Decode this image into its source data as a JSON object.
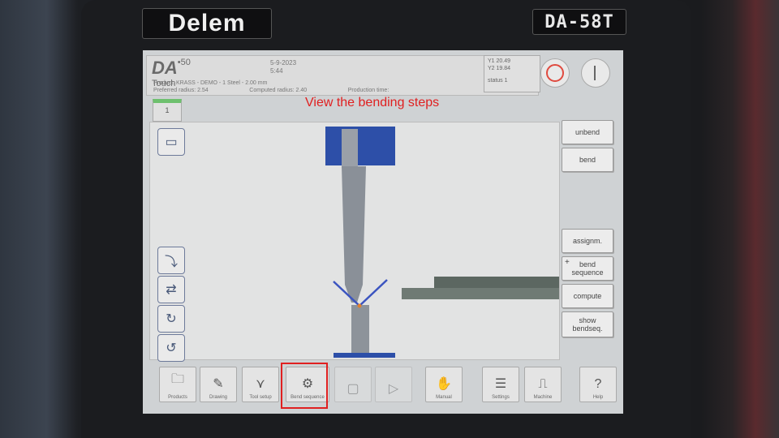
{
  "device": {
    "brand": "Delem",
    "model": "DA-58T"
  },
  "header": {
    "logo": "DA",
    "logo_sub": "50",
    "logo_tag": "Touch",
    "date": "5-9-2023",
    "time": "5:44",
    "product_line": "Product: KRASS - DEMO - 1 Steel - 2.00 mm",
    "preferred_radius": "Preferred radius: 2.54",
    "computed_radius": "Computed radius: 2.40",
    "production_time": "Production time:",
    "y1": "Y1 20.49",
    "y2": "Y2 19.84",
    "status": "status 1"
  },
  "overlay_caption": "View the bending steps",
  "step_badge": "1",
  "side_buttons": {
    "unbend": "unbend",
    "bend": "bend",
    "assignm": "assignm.",
    "bend_sequence": "bend sequence",
    "compute": "compute",
    "show_bendseq": "show bendseq."
  },
  "toolbar": {
    "product": "Products",
    "drawing": "Drawing",
    "tool_setup": "Tool setup",
    "bend_sequence": "Bend sequence",
    "manual": "Manual",
    "settings": "Settings",
    "machine": "Machine",
    "help": "Help"
  },
  "colors": {
    "accent_highlight": "#e02020",
    "tool_blue": "#2d4fa8",
    "stop_red": "#e04a3f"
  }
}
